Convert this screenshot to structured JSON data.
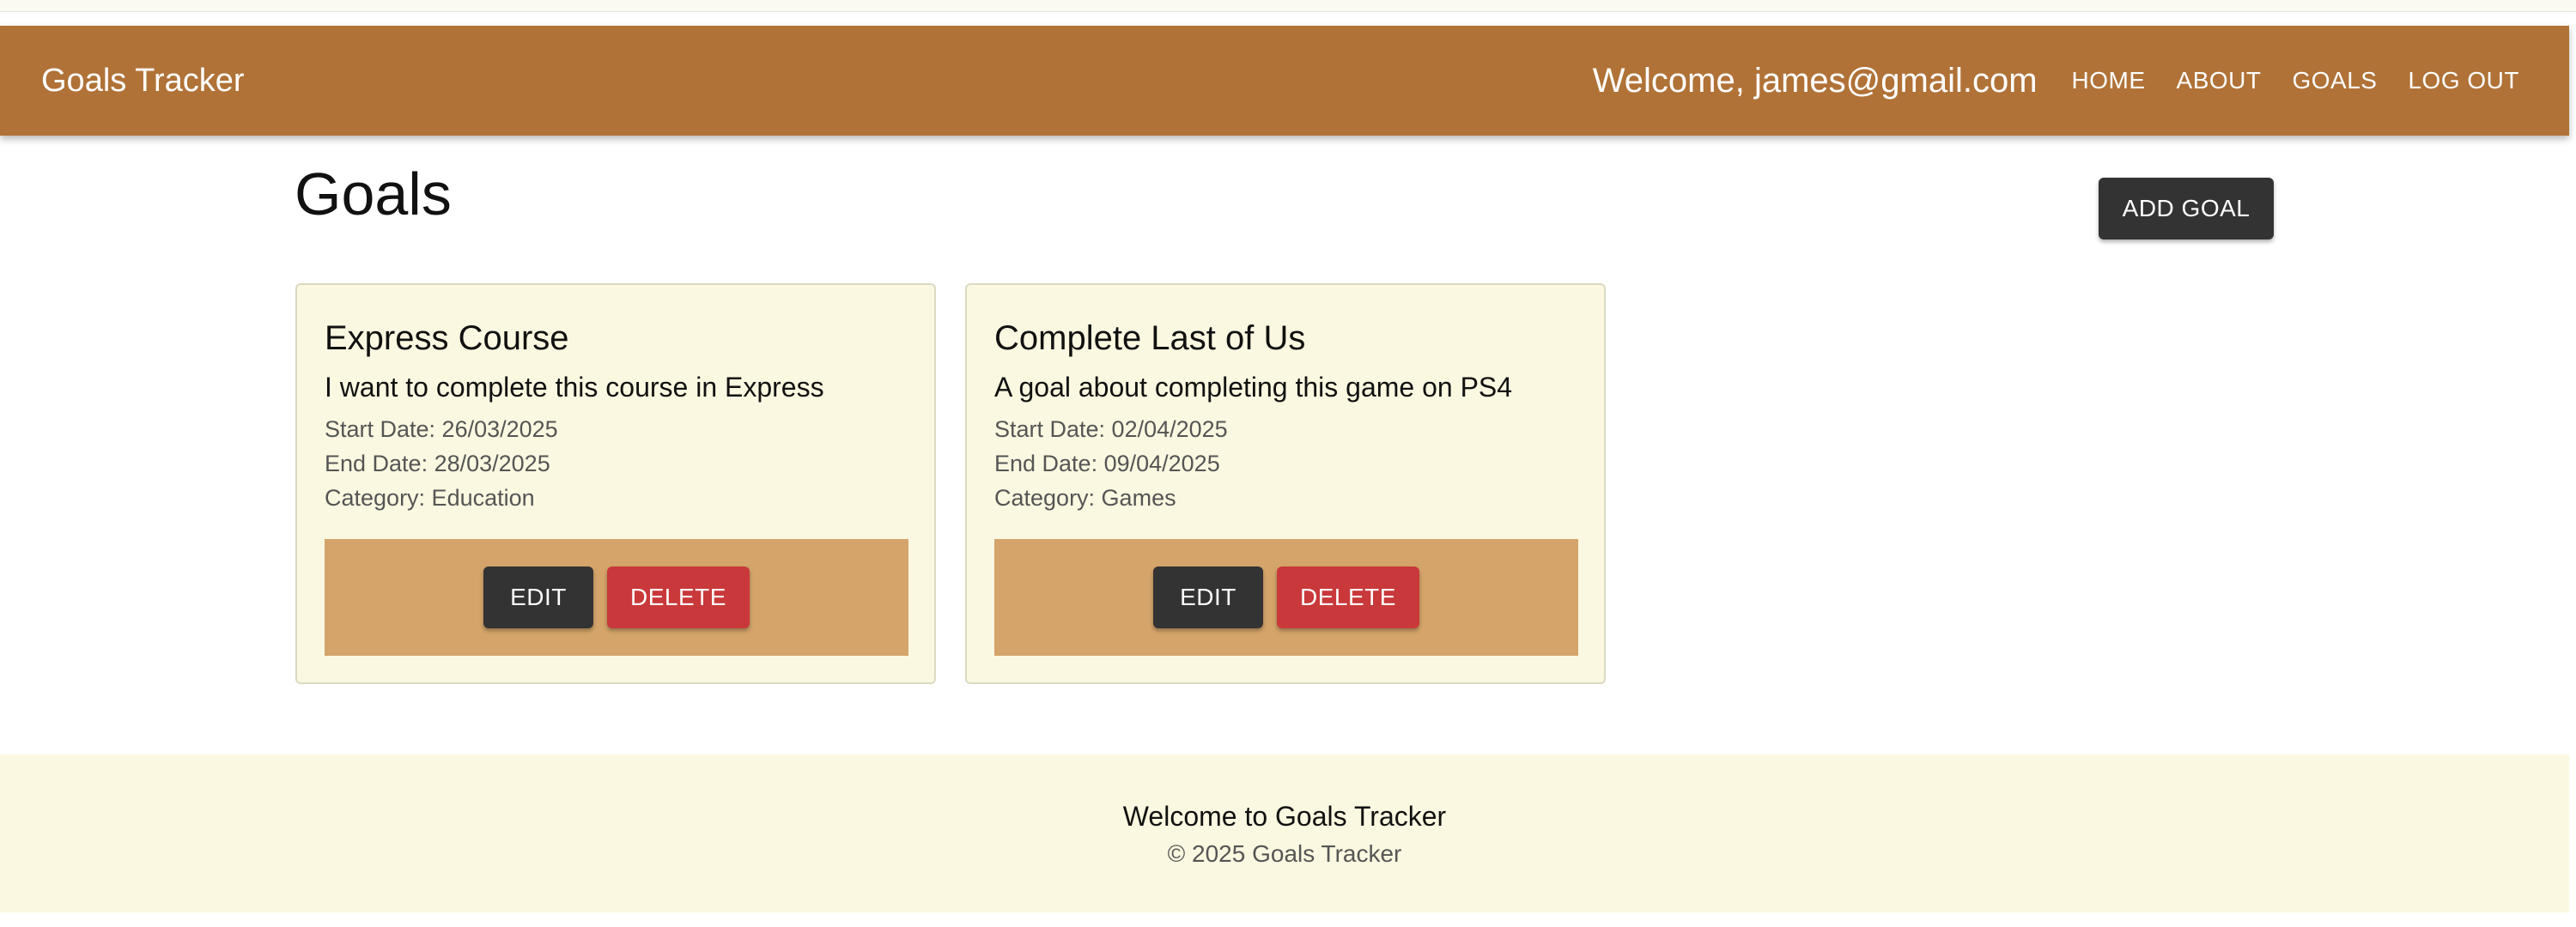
{
  "navbar": {
    "brand": "Goals Tracker",
    "welcome": "Welcome, james@gmail.com",
    "links": [
      "HOME",
      "ABOUT",
      "GOALS",
      "LOG OUT"
    ]
  },
  "page": {
    "title": "Goals",
    "add_goal_label": "ADD GOAL"
  },
  "goals": [
    {
      "title": "Express Course",
      "description": "I want to complete this course in Express",
      "start": "Start Date: 26/03/2025",
      "end": "End Date: 28/03/2025",
      "category": "Category: Education",
      "edit_label": "EDIT",
      "delete_label": "DELETE"
    },
    {
      "title": "Complete Last of Us",
      "description": "A goal about completing this game on PS4",
      "start": "Start Date: 02/04/2025",
      "end": "End Date: 09/04/2025",
      "category": "Category: Games",
      "edit_label": "EDIT",
      "delete_label": "DELETE"
    }
  ],
  "footer": {
    "title": "Welcome to Goals Tracker",
    "copyright": "© 2025 Goals Tracker"
  },
  "colors": {
    "navbar": "#b07237",
    "card_bg": "#fbf8e1",
    "card_actions_bg": "#d4a46a",
    "button_dark": "#333333",
    "button_delete": "#c9383a",
    "footer_bg": "#fbf8e1"
  }
}
